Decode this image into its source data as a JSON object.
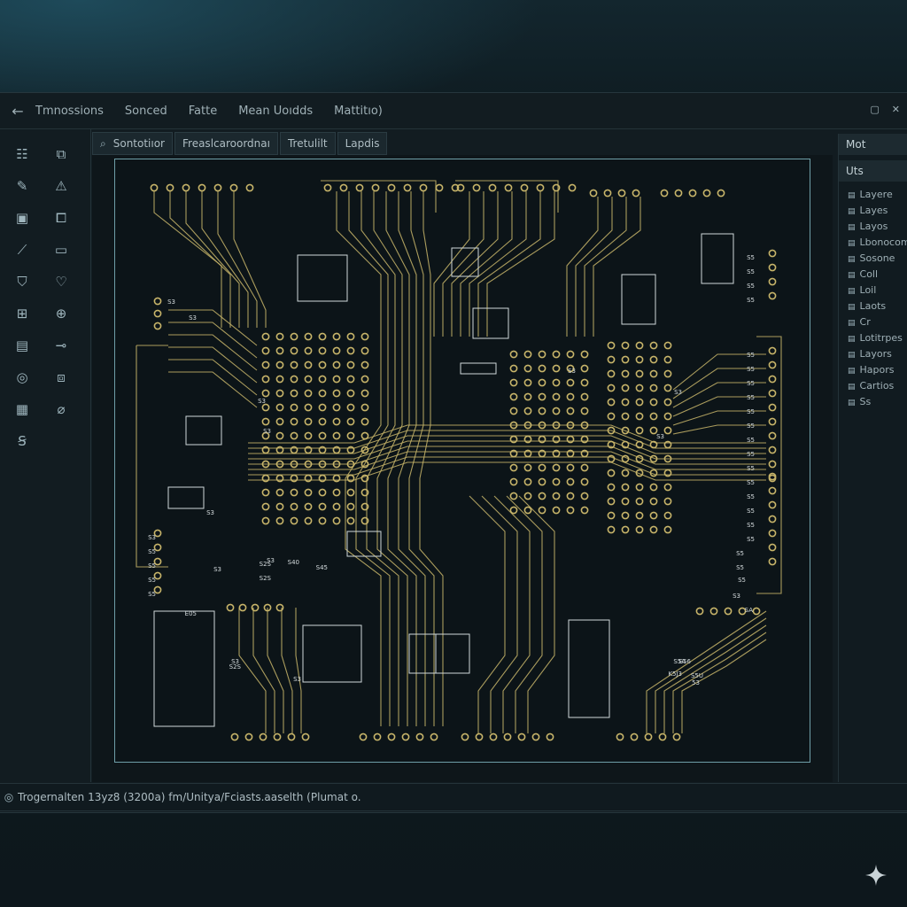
{
  "menubar": {
    "back_icon": "arrow-left-icon",
    "items": [
      "Tmnossions",
      "Sonced",
      "Fatte",
      "Mean Uoıdds",
      "Mattitıo)"
    ]
  },
  "tabs": [
    "Sontotiıor",
    "Freaslcaroordnaı",
    "Tretulilt",
    "Lapdis"
  ],
  "right_panel": {
    "header_1": "Mot",
    "header_2": "Uts",
    "items": [
      "Layere",
      "Layes",
      "Layos",
      "Lbonocom",
      "Sosone",
      "Coll",
      "Loil",
      "Laots",
      "Cr",
      "Lotitrpes",
      "Layors",
      "Hapors",
      "Cartios",
      "Ss"
    ]
  },
  "status": {
    "text": "Trogernalten 13yz8 (3200a) fm/Unitya/Fciasts.aaselth (Plumat o."
  },
  "board_labels": [
    "S5",
    "S5",
    "S5",
    "S5",
    "S5",
    "S5",
    "S5",
    "S5",
    "S5",
    "S5",
    "S5",
    "S5",
    "S5",
    "S5",
    "S5",
    "S5",
    "S5",
    "S5",
    "S3",
    "S5",
    "S5",
    "S5",
    "S5",
    "S3",
    "S3",
    "S3",
    "S3",
    "S3",
    "S3",
    "S3",
    "S3",
    "S3",
    "S3",
    "S3",
    "S3",
    "E05",
    "S2S",
    "S2S",
    "S2S",
    "S40",
    "S45",
    "S5A",
    "S5U",
    "E56",
    "K5J3",
    "53",
    "S3",
    "SA",
    "S5",
    "S5",
    "S5"
  ],
  "colors": {
    "trace": "#c8b56a",
    "board_border": "#6f9fa8",
    "accent": "#1e4a5a"
  }
}
